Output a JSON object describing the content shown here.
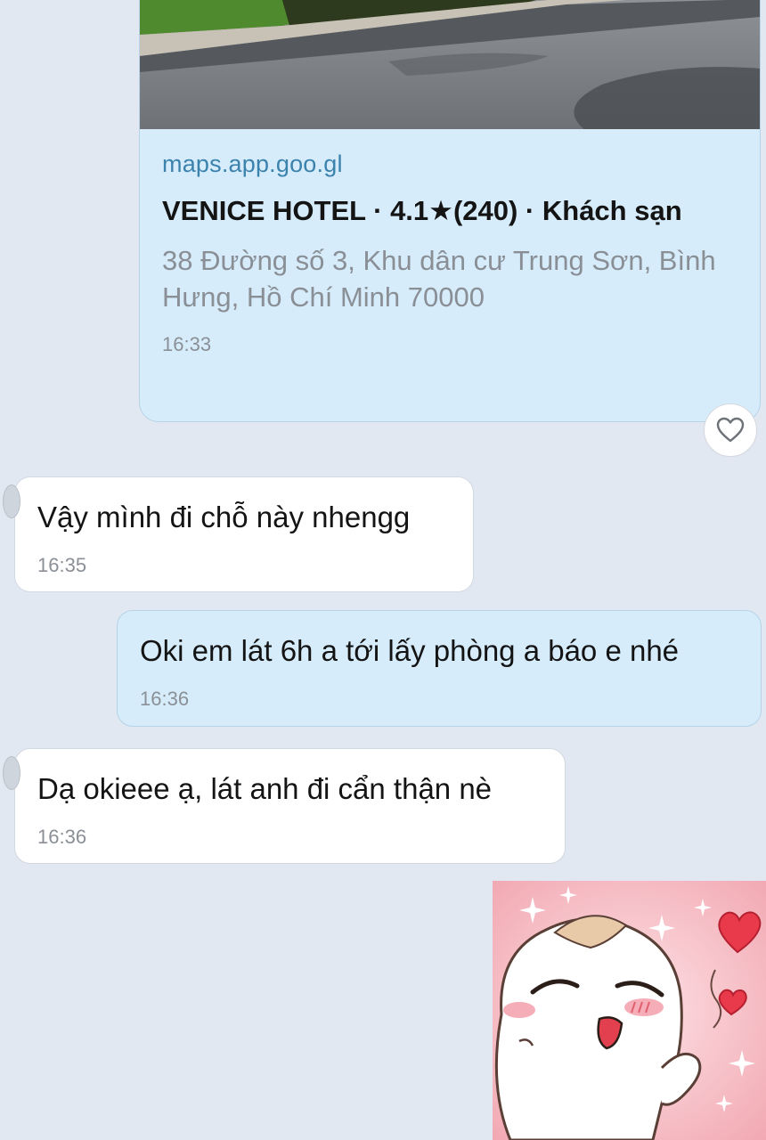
{
  "link_preview": {
    "domain": "maps.app.goo.gl",
    "title": "VENICE HOTEL · 4.1★(240) · Khách sạn",
    "address": "38 Đường số 3, Khu dân cư Trung Sơn, Bình Hưng, Hồ Chí Minh 70000",
    "time": "16:33"
  },
  "like_icon": "heart-outline-icon",
  "messages": [
    {
      "direction": "incoming",
      "text": "Vậy mình đi chỗ này nhengg",
      "time": "16:35"
    },
    {
      "direction": "outgoing",
      "text": "Oki em lát 6h a tới lấy phòng a báo e nhé",
      "time": "16:36"
    },
    {
      "direction": "incoming",
      "text": "Dạ okieee ạ, lát anh đi cẩn thận nè",
      "time": "16:36"
    }
  ],
  "sticker": {
    "icon": "blushing-mascot-sticker",
    "background": "#f4b8c0"
  }
}
